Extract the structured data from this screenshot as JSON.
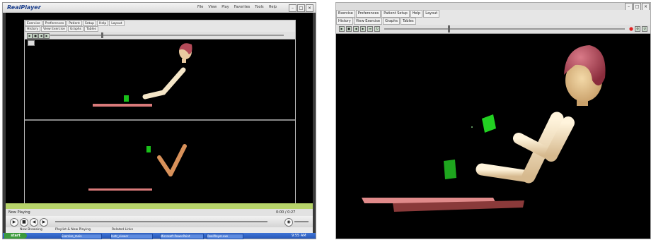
{
  "left_window": {
    "app_logo": "RealPlayer",
    "menu": [
      "File",
      "View",
      "Play",
      "Favorites",
      "Tools",
      "Help"
    ],
    "embedded_tabs_row1": [
      "Exercise",
      "Preferences",
      "Patient",
      "Setup",
      "Help",
      "Layout"
    ],
    "embedded_tabs_row2": [
      "History",
      "View Exercise",
      "Graphs",
      "Tables"
    ],
    "status_left": "Now Playing",
    "time_display": "0:00 / 0:27",
    "bottom_left": "Now Browsing",
    "bottom_mid": "Playlist & Now Playing",
    "bottom_right": "Related Links",
    "taskbar": {
      "start": "start",
      "tasks": [
        "Exercise_main",
        "Instr_viewer",
        "Microsoft PowerPoint",
        "RealPlayer.exe"
      ],
      "clock": "9:55 AM"
    }
  },
  "right_window": {
    "menu_tabs": [
      "Exercise",
      "Preferences",
      "Patient Setup",
      "Help",
      "Layout"
    ],
    "view_tabs": [
      "History",
      "View Exercise",
      "Graphs",
      "Tables"
    ]
  },
  "colors": {
    "table_pink": "#d97a7a",
    "cube_green": "#19c019",
    "skin_tone": "#e8c9a0",
    "hair": "#b34a58",
    "arm_upper": "#f5e6c8",
    "arm_lower_alt": "#d8915a"
  }
}
